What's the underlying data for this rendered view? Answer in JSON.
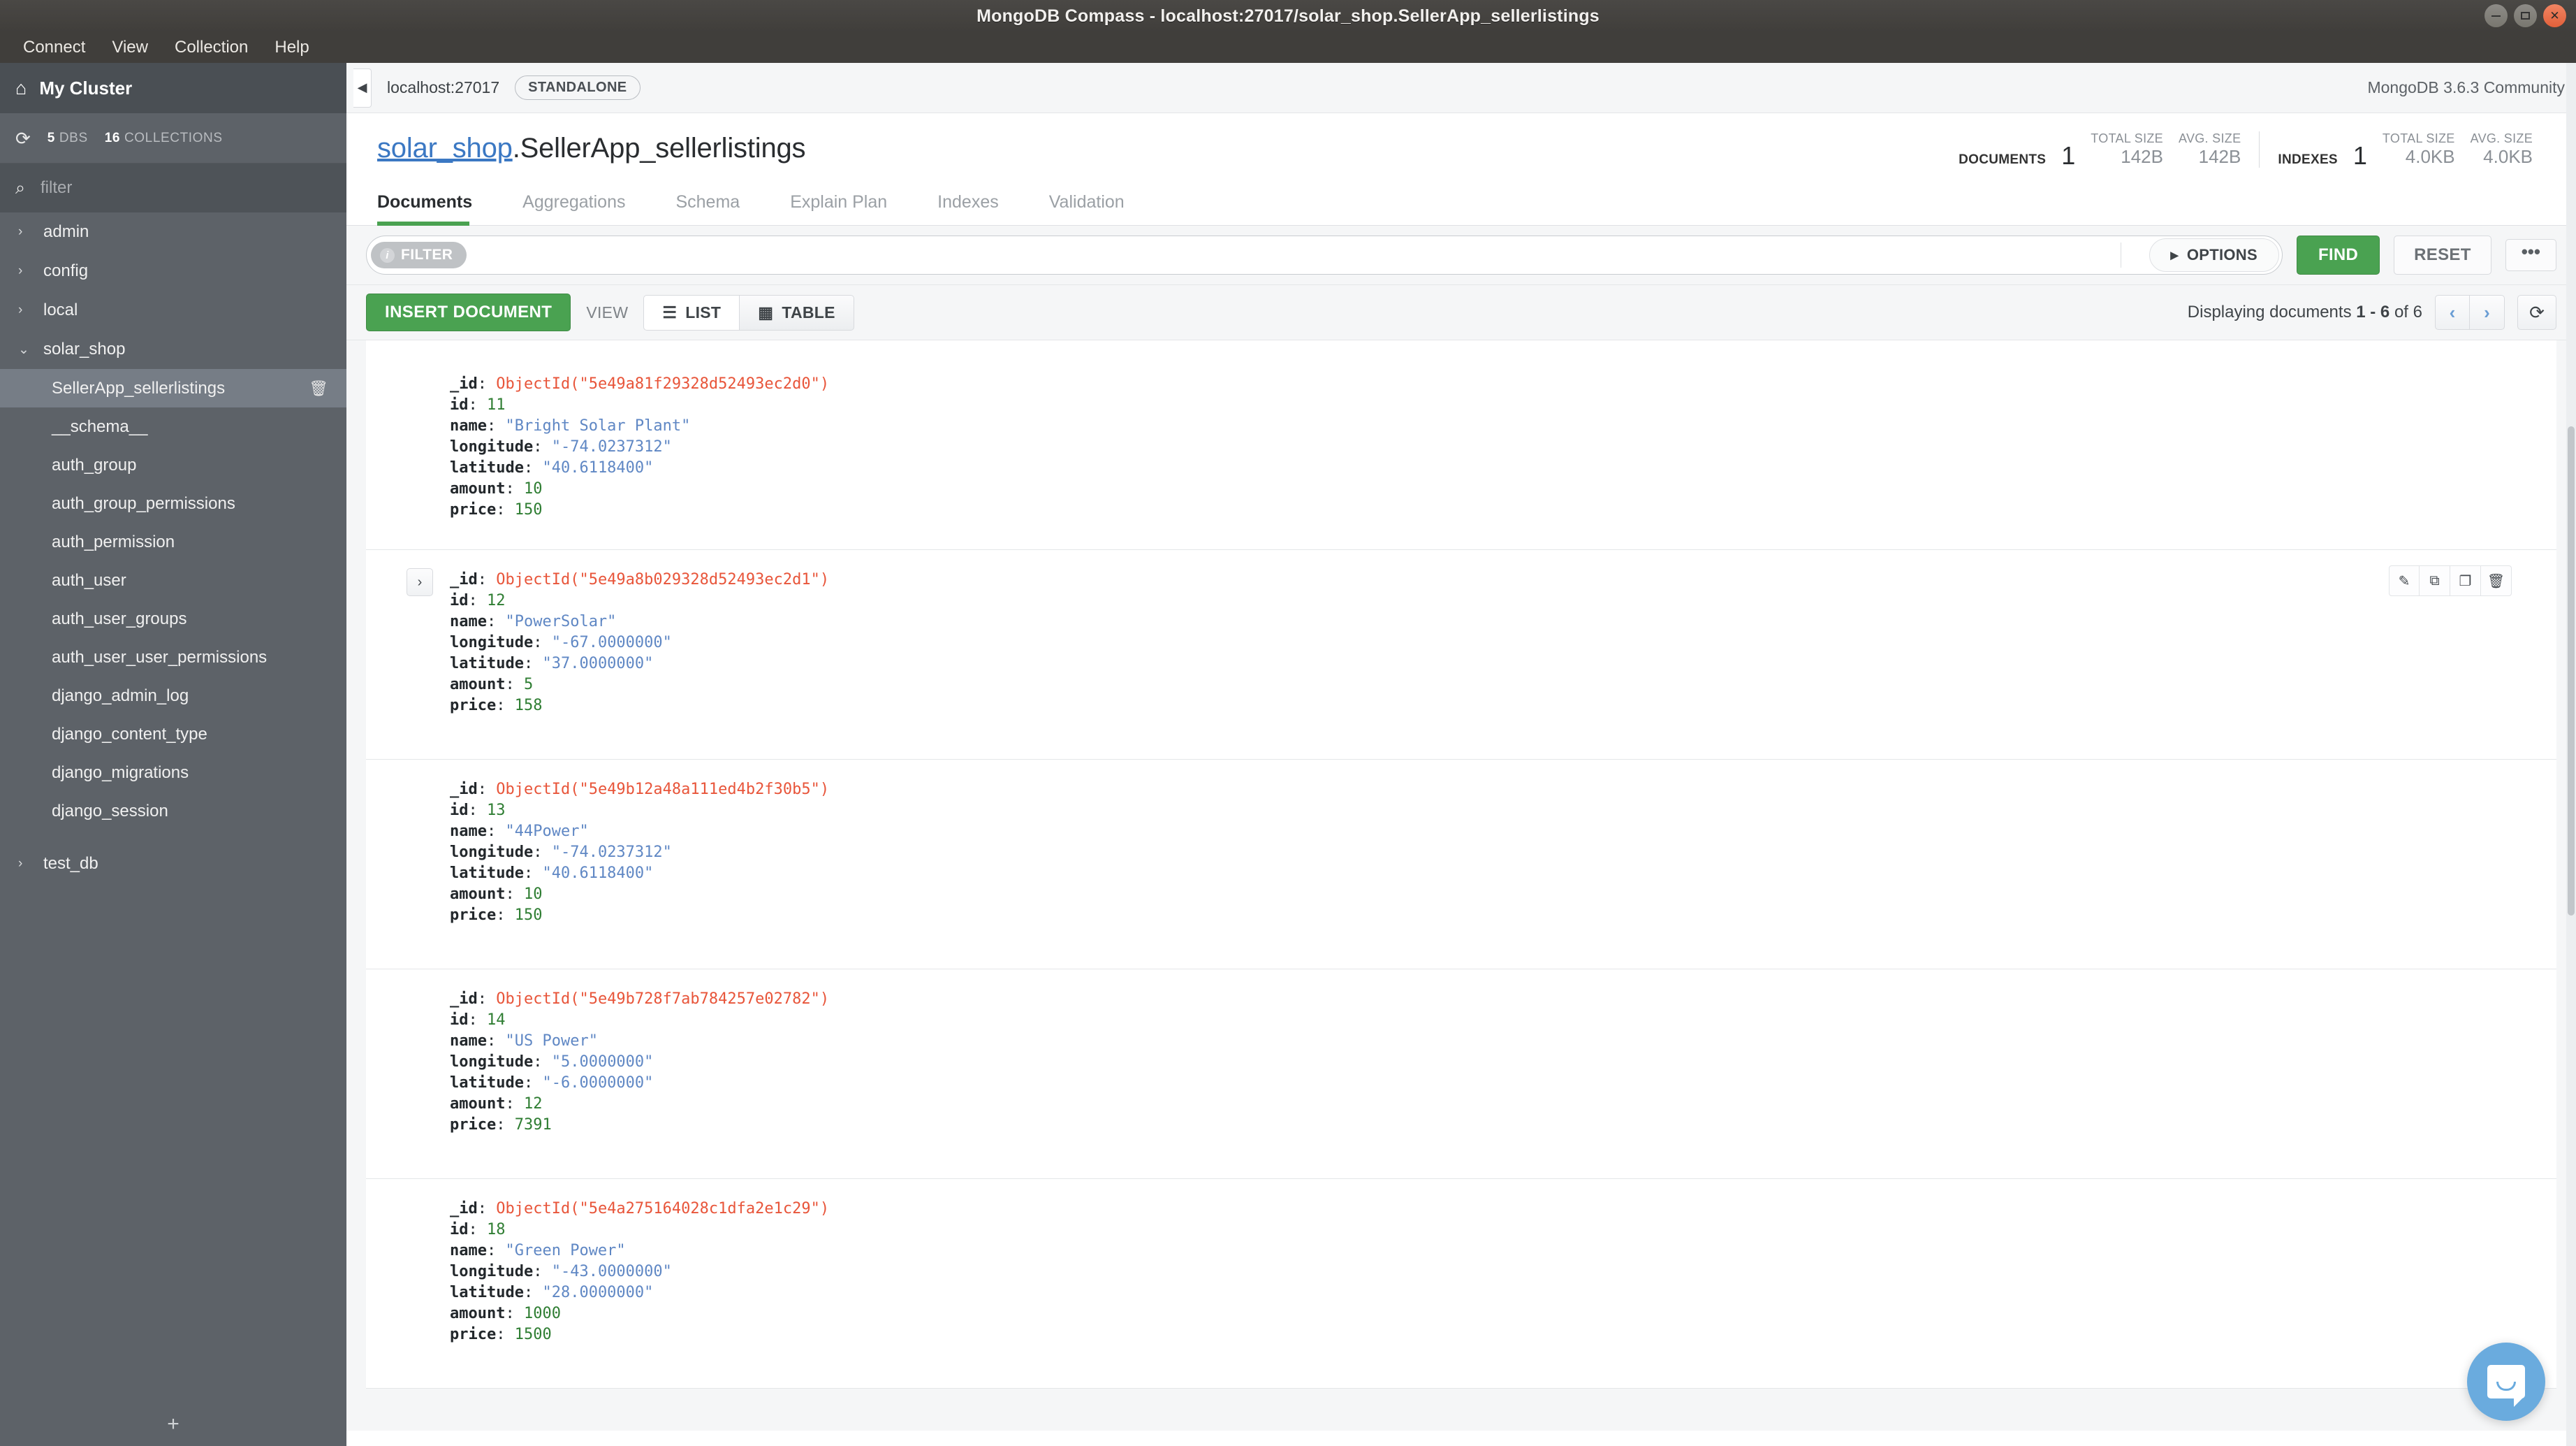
{
  "window": {
    "title": "MongoDB Compass - localhost:27017/solar_shop.SellerApp_sellerlistings",
    "minimize_label": "–",
    "maximize_label": "□",
    "close_label": "✕"
  },
  "menubar": {
    "items": [
      {
        "label": "Connect"
      },
      {
        "label": "View"
      },
      {
        "label": "Collection"
      },
      {
        "label": "Help"
      }
    ]
  },
  "sidebar": {
    "home_icon": "⌂",
    "cluster_name": "My Cluster",
    "refresh_icon": "⟳",
    "dbs_count": "5",
    "dbs_label": "DBS",
    "collections_count": "16",
    "collections_label": "COLLECTIONS",
    "search_icon": "⌕",
    "filter_placeholder": "filter",
    "filter_value": "",
    "add_label": "+",
    "trash_icon": "Ὕ1",
    "caret_collapsed": "›",
    "caret_expanded": "⌄",
    "databases": [
      {
        "name": "admin",
        "expanded": false
      },
      {
        "name": "config",
        "expanded": false
      },
      {
        "name": "local",
        "expanded": false
      },
      {
        "name": "solar_shop",
        "expanded": true
      },
      {
        "name": "test_db",
        "expanded": false
      }
    ],
    "collections": [
      {
        "name": "SellerApp_sellerlistings",
        "active": true
      },
      {
        "name": "__schema__",
        "active": false
      },
      {
        "name": "auth_group",
        "active": false
      },
      {
        "name": "auth_group_permissions",
        "active": false
      },
      {
        "name": "auth_permission",
        "active": false
      },
      {
        "name": "auth_user",
        "active": false
      },
      {
        "name": "auth_user_groups",
        "active": false
      },
      {
        "name": "auth_user_user_permissions",
        "active": false
      },
      {
        "name": "django_admin_log",
        "active": false
      },
      {
        "name": "django_content_type",
        "active": false
      },
      {
        "name": "django_migrations",
        "active": false
      },
      {
        "name": "django_session",
        "active": false
      }
    ]
  },
  "connection_bar": {
    "collapse_icon": "◀",
    "host": "localhost:27017",
    "topology_badge": "STANDALONE",
    "server_version": "MongoDB 3.6.3 Community"
  },
  "collection": {
    "database_name": "solar_shop",
    "separator": ".",
    "collection_name": "SellerApp_sellerlistings"
  },
  "stats": {
    "documents_label": "DOCUMENTS",
    "documents_count": "1",
    "documents_total_size_cap": "TOTAL SIZE",
    "documents_total_size": "142B",
    "documents_avg_size_cap": "AVG. SIZE",
    "documents_avg_size": "142B",
    "indexes_label": "INDEXES",
    "indexes_count": "1",
    "indexes_total_size_cap": "TOTAL SIZE",
    "indexes_total_size": "4.0KB",
    "indexes_avg_size_cap": "AVG. SIZE",
    "indexes_avg_size": "4.0KB"
  },
  "tabs": [
    {
      "label": "Documents",
      "active": true
    },
    {
      "label": "Aggregations",
      "active": false
    },
    {
      "label": "Schema",
      "active": false
    },
    {
      "label": "Explain Plan",
      "active": false
    },
    {
      "label": "Indexes",
      "active": false
    },
    {
      "label": "Validation",
      "active": false
    }
  ],
  "filter_bar": {
    "filter_pill_label": "FILTER",
    "filter_info_icon": "i",
    "filter_value": "",
    "options_caret": "▸",
    "options_label": "OPTIONS",
    "find_label": "FIND",
    "reset_label": "RESET",
    "more_label": "•••"
  },
  "toolbar": {
    "insert_label": "INSERT DOCUMENT",
    "view_label": "VIEW",
    "list_icon": "☰",
    "list_label": "LIST",
    "table_icon": "▦",
    "table_label": "TABLE",
    "pager_prefix": "Displaying documents",
    "pager_range": "1 - 6",
    "pager_of": "of",
    "pager_total": "6",
    "prev_icon": "‹",
    "next_icon": "›",
    "refresh_icon": "⟳"
  },
  "document_actions": {
    "expand_icon": "›",
    "edit_icon": "✎",
    "clone_icon": "⧉",
    "copy_icon": "❐",
    "delete_icon": "Ὕ1"
  },
  "documents": [
    {
      "_id": "ObjectId(\"5e49a81f29328d52493ec2d0\")",
      "id": "11",
      "name": "\"Bright Solar Plant\"",
      "longitude": "\"-74.0237312\"",
      "latitude": "\"40.6118400\"",
      "amount": "10",
      "price": "150",
      "hovered": false
    },
    {
      "_id": "ObjectId(\"5e49a8b029328d52493ec2d1\")",
      "id": "12",
      "name": "\"PowerSolar\"",
      "longitude": "\"-67.0000000\"",
      "latitude": "\"37.0000000\"",
      "amount": "5",
      "price": "158",
      "hovered": true
    },
    {
      "_id": "ObjectId(\"5e49b12a48a111ed4b2f30b5\")",
      "id": "13",
      "name": "\"44Power\"",
      "longitude": "\"-74.0237312\"",
      "latitude": "\"40.6118400\"",
      "amount": "10",
      "price": "150",
      "hovered": false
    },
    {
      "_id": "ObjectId(\"5e49b728f7ab784257e02782\")",
      "id": "14",
      "name": "\"US Power\"",
      "longitude": "\"5.0000000\"",
      "latitude": "\"-6.0000000\"",
      "amount": "12",
      "price": "7391",
      "hovered": false
    },
    {
      "_id": "ObjectId(\"5e4a275164028c1dfa2e1c29\")",
      "id": "18",
      "name": "\"Green Power\"",
      "longitude": "\"-43.0000000\"",
      "latitude": "\"28.0000000\"",
      "amount": "1000",
      "price": "1500",
      "hovered": false
    }
  ],
  "field_keys": {
    "id_key": "_id",
    "num_id_key": "id",
    "name_key": "name",
    "longitude_key": "longitude",
    "latitude_key": "latitude",
    "amount_key": "amount",
    "price_key": "price"
  },
  "colors": {
    "accent_green": "#4aa251",
    "link_blue": "#3b78c3",
    "objectid_orange": "#e8553a",
    "string_blue": "#5f87c4",
    "number_green": "#2e7d32",
    "sidebar_bg": "#5d6268",
    "chat_blue": "#6aabde"
  }
}
